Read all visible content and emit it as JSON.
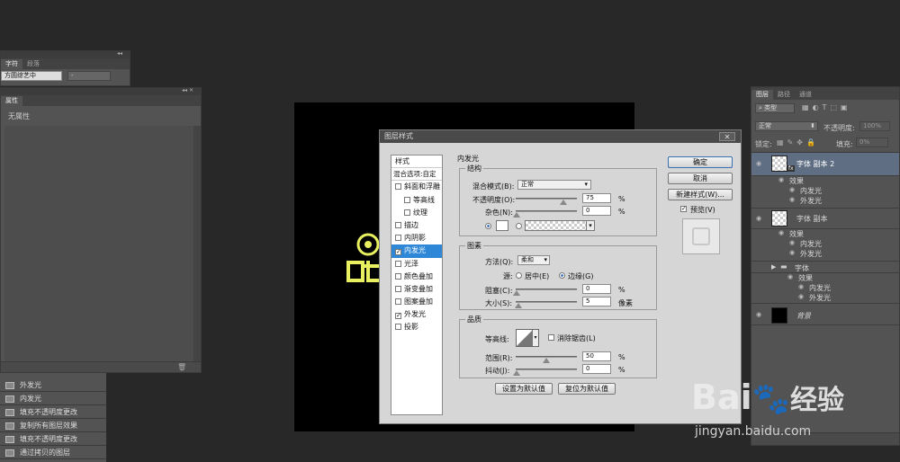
{
  "char_panel": {
    "tabs": [
      "字符",
      "段落"
    ],
    "font_name": "方圆综艺中",
    "font_style": "-"
  },
  "properties_panel": {
    "tab": "属性",
    "empty_text": "无属性"
  },
  "history_panel": {
    "items": [
      "外发光",
      "内发光",
      "填充不透明度更改",
      "复制所有图层效果",
      "填充不透明度更改",
      "通过拷贝的图层"
    ]
  },
  "dialog": {
    "title": "图层样式",
    "close_label": "✕",
    "styles_header": "样式",
    "blend_options": "混合选项:自定",
    "style_items": [
      {
        "label": "斜面和浮雕",
        "checked": false,
        "indent": false,
        "selected": false
      },
      {
        "label": "等高线",
        "checked": false,
        "indent": true,
        "selected": false
      },
      {
        "label": "纹理",
        "checked": false,
        "indent": true,
        "selected": false
      },
      {
        "label": "描边",
        "checked": false,
        "indent": false,
        "selected": false
      },
      {
        "label": "内阴影",
        "checked": false,
        "indent": false,
        "selected": false
      },
      {
        "label": "内发光",
        "checked": true,
        "indent": false,
        "selected": true
      },
      {
        "label": "光泽",
        "checked": false,
        "indent": false,
        "selected": false
      },
      {
        "label": "颜色叠加",
        "checked": false,
        "indent": false,
        "selected": false
      },
      {
        "label": "渐变叠加",
        "checked": false,
        "indent": false,
        "selected": false
      },
      {
        "label": "图案叠加",
        "checked": false,
        "indent": false,
        "selected": false
      },
      {
        "label": "外发光",
        "checked": true,
        "indent": false,
        "selected": false
      },
      {
        "label": "投影",
        "checked": false,
        "indent": false,
        "selected": false
      }
    ],
    "section_title": "内发光",
    "structure": {
      "label": "结构",
      "blend_mode_label": "混合模式(B):",
      "blend_mode_value": "正常",
      "opacity_label": "不透明度(O):",
      "opacity_value": "75",
      "noise_label": "杂色(N):",
      "noise_value": "0",
      "percent": "%"
    },
    "elements": {
      "label": "图素",
      "method_label": "方法(Q):",
      "method_value": "柔和",
      "source_label": "源:",
      "source_center": "居中(E)",
      "source_edge": "边缘(G)",
      "choke_label": "阻塞(C):",
      "choke_value": "0",
      "size_label": "大小(S):",
      "size_value": "5",
      "size_unit": "像素",
      "percent": "%"
    },
    "quality": {
      "label": "品质",
      "contour_label": "等高线:",
      "antialias_label": "消除锯齿(L)",
      "range_label": "范围(R):",
      "range_value": "50",
      "jitter_label": "抖动(J):",
      "jitter_value": "0",
      "percent": "%"
    },
    "buttons": {
      "set_default": "设置为默认值",
      "reset_default": "复位为默认值",
      "ok": "确定",
      "cancel": "取消",
      "new_style": "新建样式(W)...",
      "preview": "预览(V)"
    }
  },
  "layers_panel": {
    "tabs": [
      "图层",
      "路径",
      "通道"
    ],
    "filter_kind": "类型",
    "blend_mode": "正常",
    "opacity_label": "不透明度:",
    "opacity_value": "100%",
    "lock_label": "锁定:",
    "fill_label": "填充:",
    "fill_value": "0%",
    "layers": [
      {
        "name": "字体 副本 2",
        "effects_label": "效果",
        "effects": [
          "内发光",
          "外发光"
        ]
      },
      {
        "name": "字体 副本",
        "effects_label": "效果",
        "effects": [
          "内发光",
          "外发光"
        ]
      },
      {
        "name": "字体",
        "effects_label": "效果",
        "effects": [
          "内发光",
          "外发光"
        ]
      },
      {
        "name": "背景"
      }
    ]
  },
  "watermark": {
    "brand": "Bai",
    "brand2": "经验",
    "url": "jingyan.baidu.com"
  }
}
